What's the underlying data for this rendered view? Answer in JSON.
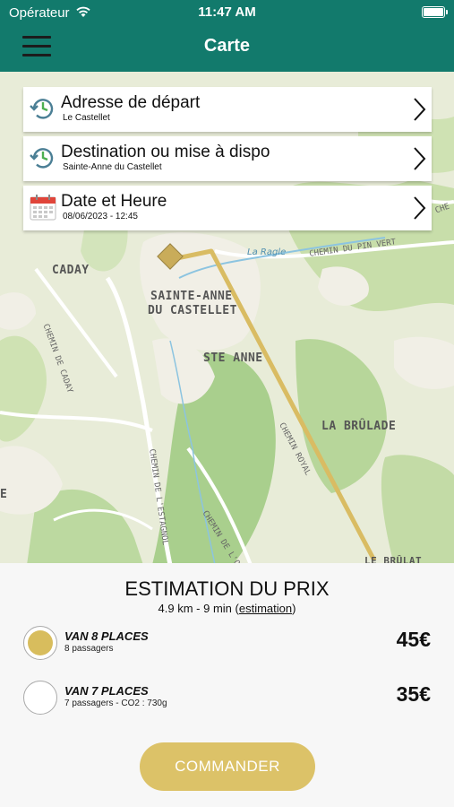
{
  "status": {
    "carrier": "Opérateur",
    "time": "11:47 AM",
    "battery_level": 1.0
  },
  "header": {
    "title": "Carte"
  },
  "map": {
    "places": [
      "CADAY",
      "SAINTE-ANNE",
      "DU CASTELLET",
      "STE ANNE",
      "LA BRÛLADE",
      "LE BRÛLAT",
      "E"
    ],
    "roads": [
      "CHEMIN DE CADAY",
      "CHEMIN DU PIN VERT",
      "CHEMIN ROYAL",
      "CHEMIN DE L'ESTAGNOL",
      "CHEMIN DE L'O",
      "CHE"
    ],
    "water": "La Ragle",
    "route_color": "#d9bc63"
  },
  "fields": [
    {
      "label": "Adresse de départ",
      "value": "Le Castellet",
      "icon": "history-icon"
    },
    {
      "label": "Destination ou mise à dispo",
      "value": "Sainte-Anne du Castellet",
      "icon": "history-icon"
    },
    {
      "label": "Date et Heure",
      "value": "08/06/2023 - 12:45",
      "icon": "calendar-icon"
    }
  ],
  "estimate": {
    "title": "ESTIMATION DU PRIX",
    "summary": "4.9 km - 9 min",
    "link": "estimation",
    "options": [
      {
        "name": "VAN 8 PLACES",
        "desc": "8 passagers",
        "price": "45€",
        "selected": true
      },
      {
        "name": "VAN 7 PLACES",
        "desc": "7 passagers - CO2 : 730g",
        "price": "35€",
        "selected": false
      }
    ],
    "order_label": "COMMANDER"
  },
  "colors": {
    "header": "#127a6c",
    "accent": "#d8bd5d",
    "button": "#dcc268"
  }
}
